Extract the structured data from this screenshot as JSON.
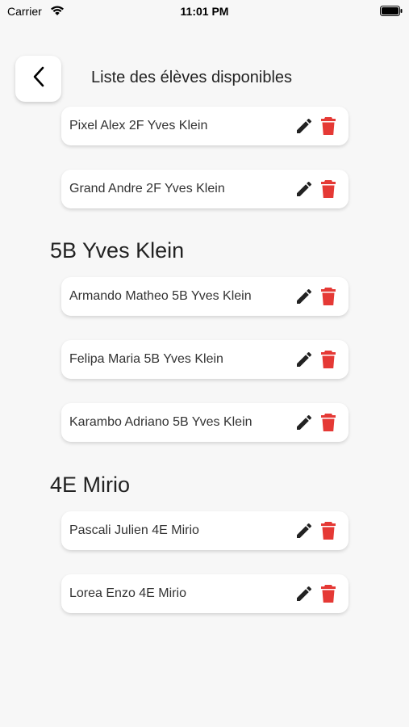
{
  "status_bar": {
    "carrier": "Carrier",
    "time": "11:01 PM"
  },
  "header": {
    "title": "Liste des élèves disponibles",
    "back_icon": "chevron-left-icon"
  },
  "colors": {
    "background": "#f7f7f7",
    "card": "#ffffff",
    "delete_icon": "#e53935",
    "edit_icon": "#222222"
  },
  "groups": [
    {
      "title": "",
      "students": [
        {
          "name": "Pixel Alex 2F Yves Klein"
        },
        {
          "name": "Grand Andre 2F Yves Klein"
        }
      ]
    },
    {
      "title": "5B Yves Klein",
      "students": [
        {
          "name": "Armando Matheo 5B Yves Klein"
        },
        {
          "name": "Felipa Maria 5B Yves Klein"
        },
        {
          "name": "Karambo Adriano 5B Yves Klein"
        }
      ]
    },
    {
      "title": "4E Mirio",
      "students": [
        {
          "name": "Pascali Julien 4E Mirio"
        },
        {
          "name": "Lorea Enzo 4E Mirio"
        }
      ]
    }
  ]
}
